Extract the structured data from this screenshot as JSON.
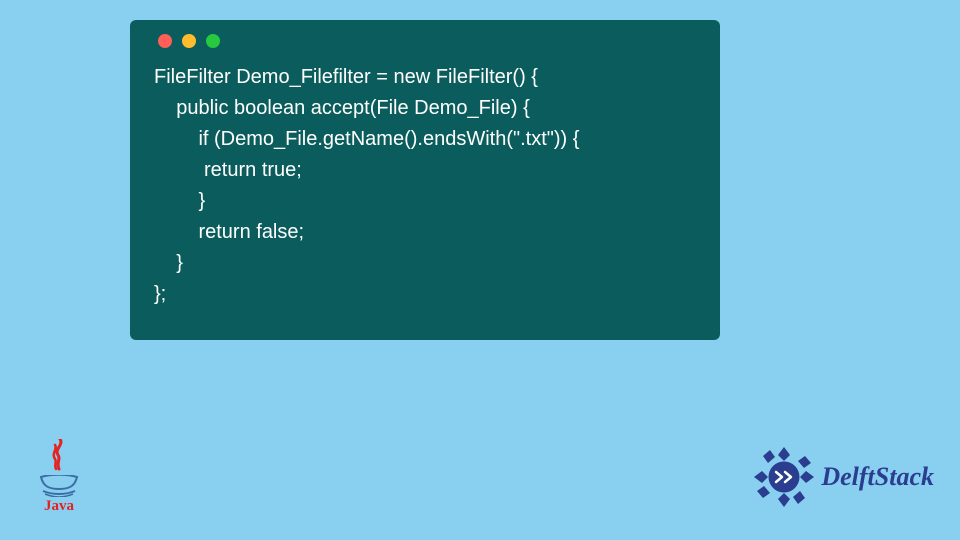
{
  "code": {
    "lines": [
      "FileFilter Demo_Filefilter = new FileFilter() {",
      "    public boolean accept(File Demo_File) {",
      "        if (Demo_File.getName().endsWith(\".txt\")) {",
      "         return true;",
      "        }",
      "        return false;",
      "    }",
      "};"
    ]
  },
  "traffic_lights": {
    "red": "#ff5f56",
    "yellow": "#ffbd2e",
    "green": "#27c93f"
  },
  "java_logo": {
    "text": "Java"
  },
  "delft_logo": {
    "text": "DelftStack"
  },
  "colors": {
    "page_bg": "#89cff0",
    "window_bg": "#0b5d5d",
    "code_fg": "#ffffff",
    "java_red": "#e52222",
    "delft_blue": "#2a3d8f"
  }
}
